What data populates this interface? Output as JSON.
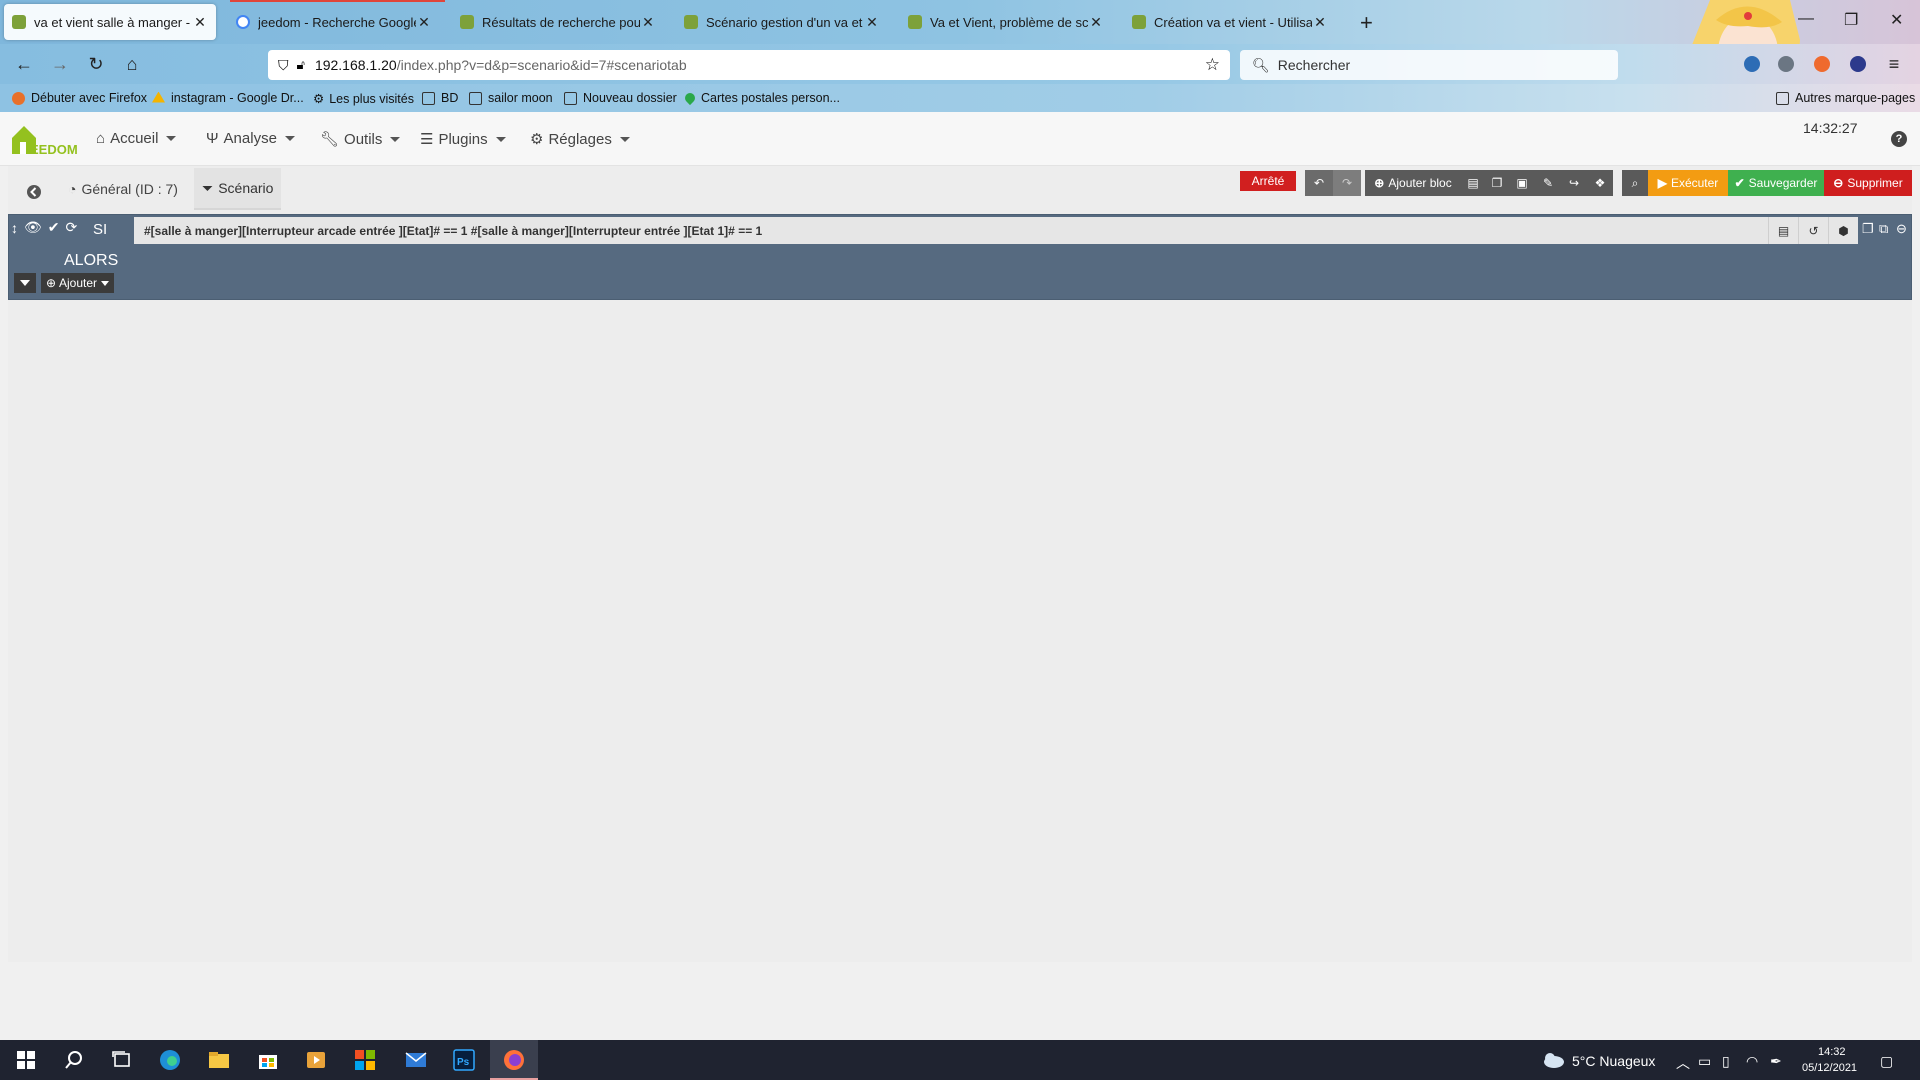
{
  "browser": {
    "tabs": [
      {
        "title": "va et vient salle à manger - Jeed",
        "active": true
      },
      {
        "title": "jeedom - Recherche Google",
        "active": false
      },
      {
        "title": "Résultats de recherche pour « v",
        "active": false
      },
      {
        "title": "Scénario gestion d'un va et vien",
        "active": false
      },
      {
        "title": "Va et Vient, problème de scénar",
        "active": false
      },
      {
        "title": "Création va et vient - Utilisation",
        "active": false
      }
    ],
    "url_host": "192.168.1.20",
    "url_path": "/index.php?v=d&p=scenario&id=7#scenariotab",
    "search_placeholder": "Rechercher",
    "bookmarks": [
      "Débuter avec Firefox",
      "instagram - Google Dr...",
      "Les plus visités",
      "BD",
      "sailor moon",
      "Nouveau dossier",
      "Cartes postales person..."
    ],
    "other_bookmarks": "Autres marque-pages"
  },
  "header": {
    "logo_text": "EEDOM",
    "menu": [
      "Accueil",
      "Analyse",
      "Outils",
      "Plugins",
      "Réglages"
    ],
    "clock": "14:32:27"
  },
  "toolbar": {
    "tab_general": "Général (ID : 7)",
    "tab_scenario": "Scénario",
    "status": "Arrêté",
    "add_block": "Ajouter bloc",
    "execute": "Exécuter",
    "save": "Sauvegarder",
    "delete": "Supprimer"
  },
  "block": {
    "if_label": "SI",
    "then_label": "ALORS",
    "condition": "#[salle à manger][Interrupteur arcade entrée ][Etat]# == 1  #[salle à manger][Interrupteur entrée ][Etat 1]# == 1",
    "add_label": "Ajouter"
  },
  "taskbar": {
    "weather": "5°C  Nuageux",
    "time": "14:32",
    "date": "05/12/2021"
  },
  "colors": {
    "block_bg": "#566a80",
    "status_stopped": "#d11f1f",
    "execute": "#f39c12",
    "save": "#3fb04f",
    "delete": "#cf1e1e"
  }
}
